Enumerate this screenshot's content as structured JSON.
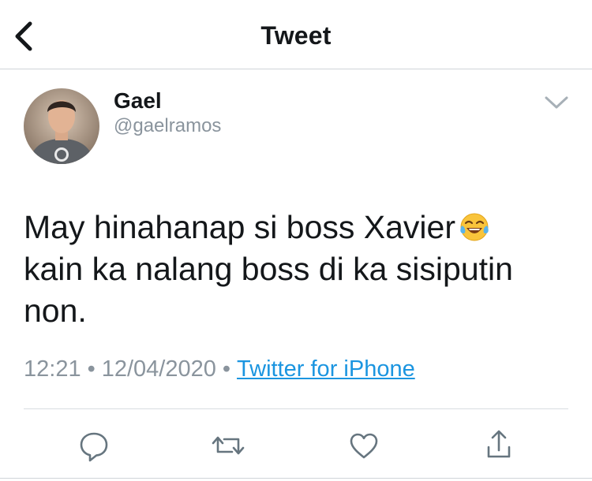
{
  "header": {
    "title": "Tweet",
    "back_icon": "chevron-left-icon"
  },
  "tweet": {
    "author": {
      "display_name": "Gael",
      "handle": "@gaelramos"
    },
    "text_line_1": "May hinahanap si boss Xavier",
    "text_line_2": "kain ka nalang boss di ka sisiputin",
    "text_line_3": "non.",
    "emoji": "face-with-tears-of-joy",
    "time": "12:21",
    "separator": "•",
    "date": "12/04/2020",
    "source": "Twitter for iPhone"
  },
  "actions": {
    "icons": [
      "reply-icon",
      "retweet-icon",
      "like-icon",
      "share-icon"
    ]
  },
  "colors": {
    "link": "#1b95e0",
    "secondary_text": "#8a949d",
    "icon": "#66757f",
    "divider": "#d8dde1"
  }
}
